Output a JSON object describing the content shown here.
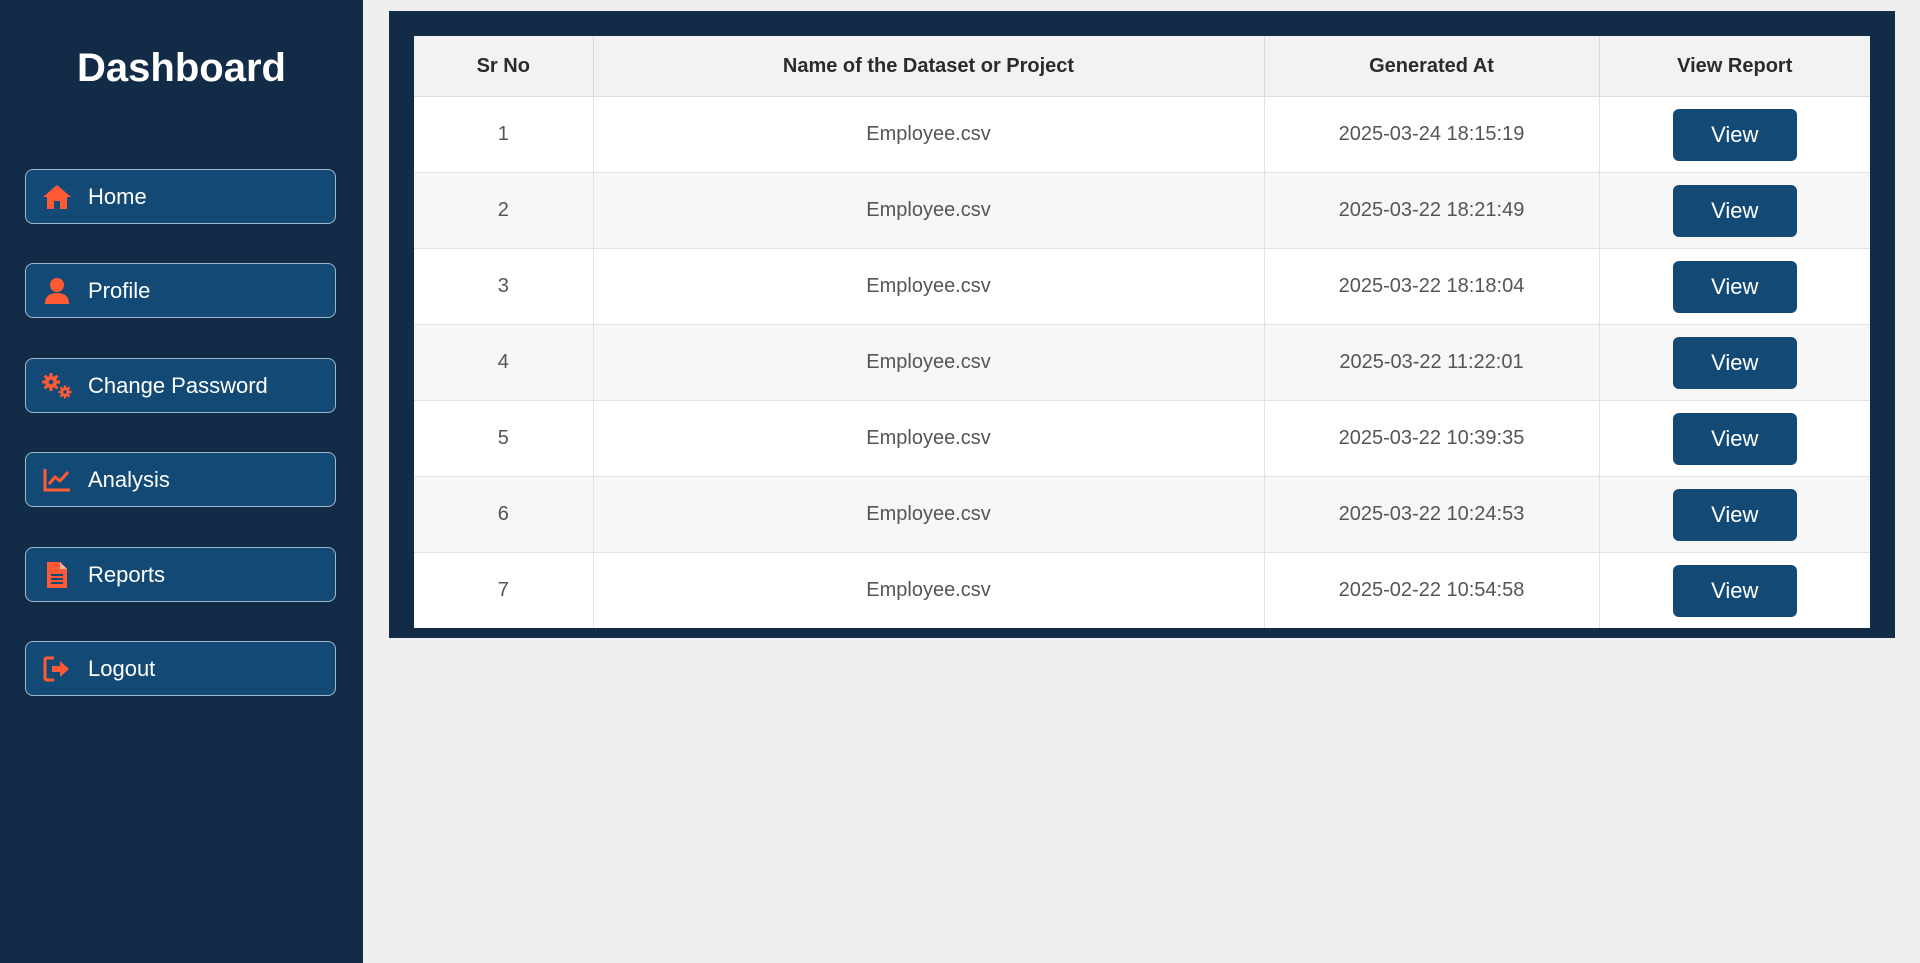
{
  "sidebar": {
    "title": "Dashboard",
    "accent_color": "#ff5a33",
    "items": [
      {
        "label": "Home",
        "icon": "home-icon"
      },
      {
        "label": "Profile",
        "icon": "user-icon"
      },
      {
        "label": "Change Password",
        "icon": "gears-icon"
      },
      {
        "label": "Analysis",
        "icon": "line-chart-icon"
      },
      {
        "label": "Reports",
        "icon": "file-icon"
      },
      {
        "label": "Logout",
        "icon": "sign-out-icon"
      }
    ]
  },
  "table": {
    "headers": [
      "Sr No",
      "Name of the Dataset or Project",
      "Generated At",
      "View Report"
    ],
    "rows": [
      {
        "sr": "1",
        "name": "Employee.csv",
        "generated": "2025-03-24 18:15:19",
        "action": "View"
      },
      {
        "sr": "2",
        "name": "Employee.csv",
        "generated": "2025-03-22 18:21:49",
        "action": "View"
      },
      {
        "sr": "3",
        "name": "Employee.csv",
        "generated": "2025-03-22 18:18:04",
        "action": "View"
      },
      {
        "sr": "4",
        "name": "Employee.csv",
        "generated": "2025-03-22 11:22:01",
        "action": "View"
      },
      {
        "sr": "5",
        "name": "Employee.csv",
        "generated": "2025-03-22 10:39:35",
        "action": "View"
      },
      {
        "sr": "6",
        "name": "Employee.csv",
        "generated": "2025-03-22 10:24:53",
        "action": "View"
      },
      {
        "sr": "7",
        "name": "Employee.csv",
        "generated": "2025-02-22 10:54:58",
        "action": "View"
      }
    ]
  }
}
